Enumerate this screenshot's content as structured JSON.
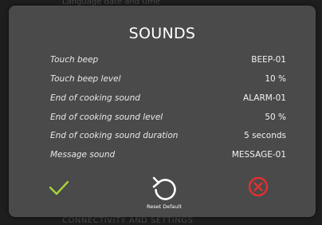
{
  "background": {
    "top_text": "Language date and time",
    "bottom_text": "CONNECTIVITY AND SETTINGS"
  },
  "dialog": {
    "title": "SOUNDS",
    "rows": [
      {
        "label": "Touch beep",
        "value": "BEEP-01"
      },
      {
        "label": "Touch beep level",
        "value": "10 %"
      },
      {
        "label": "End of cooking sound",
        "value": "ALARM-01"
      },
      {
        "label": "End of cooking sound level",
        "value": "50 %"
      },
      {
        "label": "End of cooking sound duration",
        "value": "5 seconds"
      },
      {
        "label": "Message sound",
        "value": "MESSAGE-01"
      }
    ],
    "buttons": {
      "confirm_icon": "checkmark-icon",
      "reset_icon": "reset-arrow-icon",
      "reset_label": "Reset Default",
      "cancel_icon": "close-circle-icon"
    }
  },
  "colors": {
    "dialog_bg": "#4a4a4a",
    "confirm": "#a8d23a",
    "cancel": "#e0312f",
    "text": "#ffffff"
  }
}
